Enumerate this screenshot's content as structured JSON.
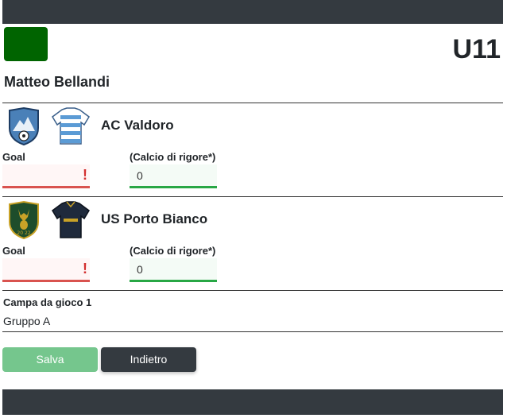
{
  "header": {
    "age_group": "U11",
    "logo_color": "#006400"
  },
  "referee_name": "Matteo Bellandi",
  "teams": [
    {
      "name": "AC Valdoro",
      "goal_label": "Goal",
      "penalty_label": "(Calcio di rigore*)",
      "goal_value": "",
      "penalty_value": "0"
    },
    {
      "name": "US Porto Bianco",
      "goal_label": "Goal",
      "penalty_label": "(Calcio di rigore*)",
      "goal_value": "",
      "penalty_value": "0"
    }
  ],
  "match": {
    "field": "Campa da gioco 1",
    "group": "Gruppo A"
  },
  "actions": {
    "save_label": "Salva",
    "back_label": "Indietro"
  },
  "colors": {
    "dark_bar": "#343a40",
    "error": "#d9534f",
    "success": "#28a745"
  }
}
